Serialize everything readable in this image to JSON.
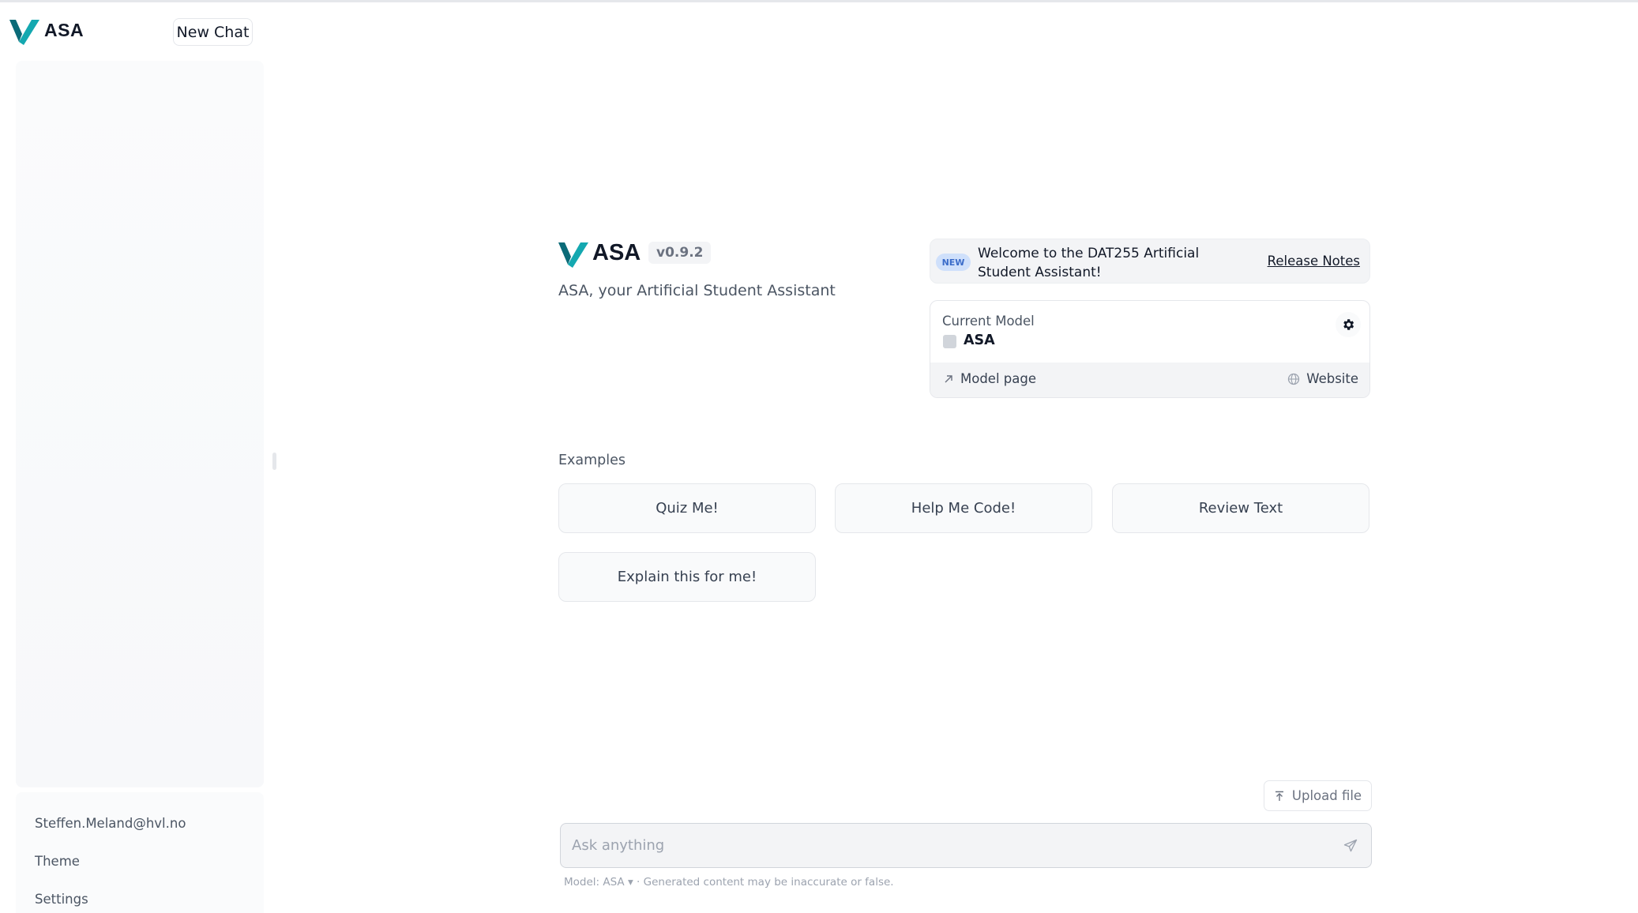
{
  "sidebar": {
    "brand": "ASA",
    "new_chat_label": "New Chat",
    "user_email": "Steffen.Meland@hvl.no",
    "theme_label": "Theme",
    "settings_label": "Settings"
  },
  "hero": {
    "brand": "ASA",
    "version": "v0.9.2",
    "subtitle": "ASA, your Artificial Student Assistant"
  },
  "announcement": {
    "badge": "NEW",
    "text": "Welcome to the DAT255 Artificial Student Assistant!",
    "link_label": "Release Notes"
  },
  "model_card": {
    "label": "Current Model",
    "model_name": "ASA",
    "model_page_label": "Model page",
    "website_label": "Website"
  },
  "examples": {
    "label": "Examples",
    "items": [
      "Quiz Me!",
      "Help Me Code!",
      "Review Text",
      "Explain this for me!"
    ]
  },
  "composer": {
    "upload_label": "Upload file",
    "placeholder": "Ask anything"
  },
  "footnote": {
    "model_label": "Model: ASA",
    "disclaimer": "· Generated content may be inaccurate or false."
  },
  "colors": {
    "logo_teal": "#14a8b0",
    "logo_dark": "#0b6b78",
    "badge_bg": "#cfe0fb",
    "badge_text": "#3b6cc9"
  }
}
